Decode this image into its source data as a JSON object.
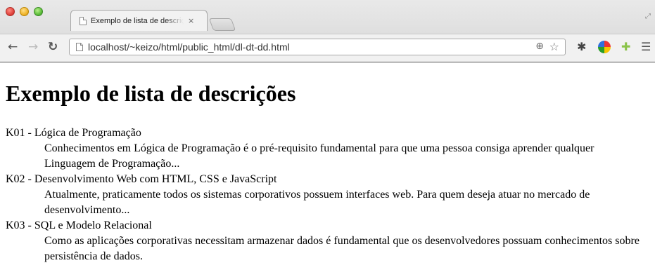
{
  "tab": {
    "title": "Exemplo de lista de descrições",
    "close_glyph": "×"
  },
  "toolbar": {
    "url": "localhost/~keizo/html/public_html/dl-dt-dd.html"
  },
  "icons": {
    "back": "back-arrow-icon",
    "forward": "forward-arrow-icon",
    "reload": "reload-icon",
    "zoom": "zoom-icon",
    "star": "star-icon",
    "gear": "gear-icon",
    "color_wheel": "color-wheel-icon",
    "android": "android-icon",
    "menu": "menu-icon"
  },
  "page": {
    "heading": "Exemplo de lista de descrições",
    "items": [
      {
        "term": "K01 - Lógica de Programação",
        "description": "Conhecimentos em Lógica de Programação é o pré-requisito fundamental para que uma pessoa consiga aprender qualquer Linguagem de Programação..."
      },
      {
        "term": "K02 - Desenvolvimento Web com HTML, CSS e JavaScript",
        "description": "Atualmente, praticamente todos os sistemas corporativos possuem interfaces web. Para quem deseja atuar no mercado de desenvolvimento..."
      },
      {
        "term": "K03 - SQL e Modelo Relacional",
        "description": "Como as aplicações corporativas necessitam armazenar dados é fundamental que os desenvolvedores possuam conhecimentos sobre persistência de dados."
      }
    ]
  }
}
